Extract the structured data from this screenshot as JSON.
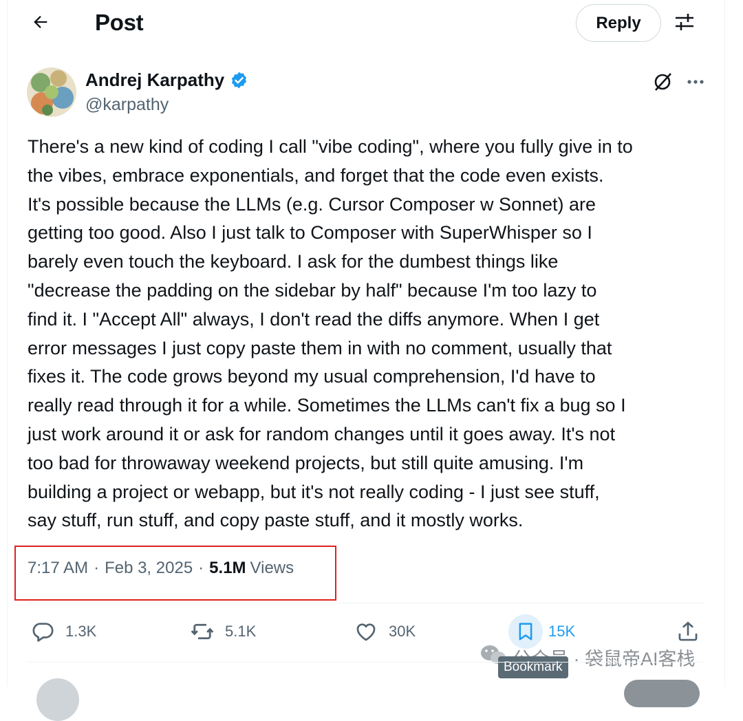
{
  "header": {
    "title": "Post",
    "reply_label": "Reply"
  },
  "author": {
    "name": "Andrej Karpathy",
    "handle": "@karpathy",
    "verified": true
  },
  "tweet": {
    "lines": [
      "There's a new kind of coding I call \"vibe coding\", where you fully give in to",
      "the vibes, embrace exponentials, and forget that the code even exists.",
      "It's possible because the LLMs (e.g. Cursor Composer w Sonnet) are",
      "getting too good. Also I just talk to Composer with SuperWhisper so I",
      "barely even touch the keyboard. I ask for the dumbest things like",
      "\"decrease the padding on the sidebar by half\" because I'm too lazy to",
      "find it. I \"Accept All\" always, I don't read the diffs anymore. When I get",
      "error messages I just copy paste them in with no comment, usually that",
      "fixes it. The code grows beyond my usual comprehension, I'd have to",
      "really read through it for a while. Sometimes the LLMs can't fix a bug so I",
      "just work around it or ask for random changes until it goes away. It's not",
      "too bad for throwaway weekend projects, but still quite amusing. I'm",
      "building a project or webapp, but it's not really coding - I just see stuff,",
      "say stuff, run stuff, and copy paste stuff, and it mostly works."
    ]
  },
  "meta": {
    "time": "7:17 AM",
    "separator": "·",
    "date": "Feb 3, 2025",
    "views_count": "5.1M",
    "views_label": "Views"
  },
  "actions": {
    "replies": "1.3K",
    "reposts": "5.1K",
    "likes": "30K",
    "bookmarks": "15K",
    "bookmark_tooltip": "Bookmark"
  },
  "watermark": {
    "text": "公众号 · 袋鼠帝AI客栈"
  },
  "colors": {
    "accent": "#1d9bf0",
    "text_primary": "#0f1419",
    "text_secondary": "#536471",
    "highlight_box": "#e02020"
  },
  "icons": {
    "back": "arrow-left-icon",
    "settings": "sliders-icon",
    "verified": "verified-badge-icon",
    "grok": "grok-icon",
    "more": "more-dots-icon",
    "reply": "comment-icon",
    "repost": "repost-icon",
    "like": "heart-icon",
    "bookmark": "bookmark-icon",
    "share": "share-icon",
    "watermark": "wechat-icon"
  }
}
